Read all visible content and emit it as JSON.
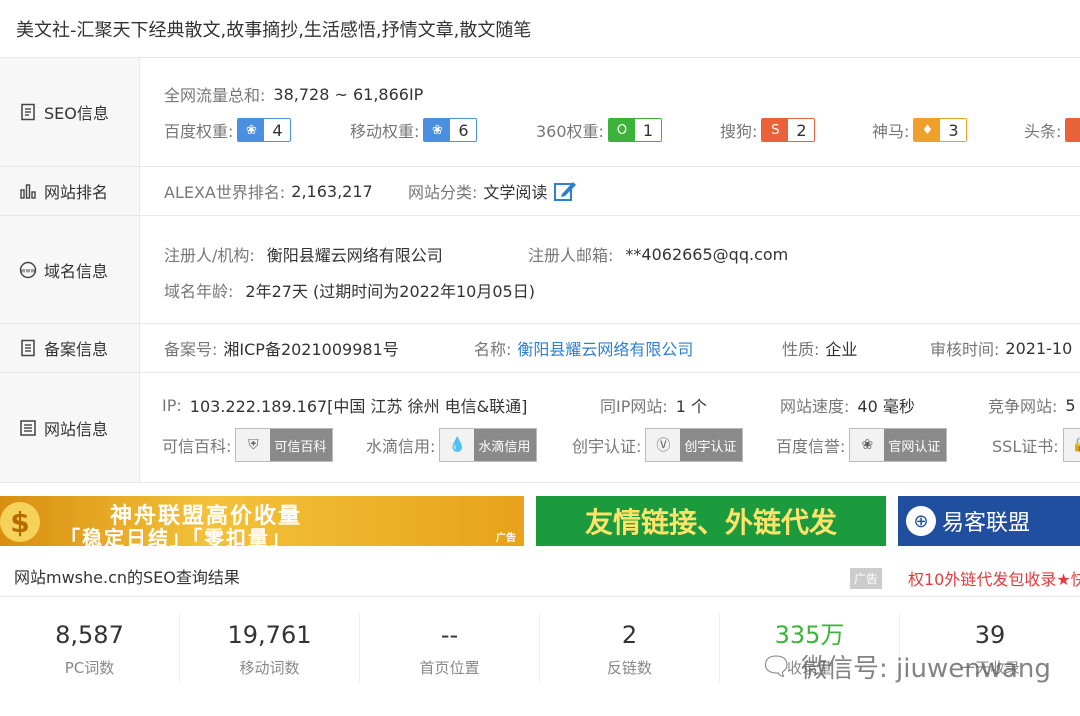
{
  "page_title": "美文社-汇聚天下经典散文,故事摘抄,生活感悟,抒情文章,散文随笔",
  "seo": {
    "label": "SEO信息",
    "traffic_key": "全网流量总和:",
    "traffic_value": "38,728 ~ 61,866IP",
    "ranks": [
      {
        "key": "百度权重:",
        "value": "4",
        "color": "#4a8fe0",
        "icon": "paw-icon"
      },
      {
        "key": "移动权重:",
        "value": "6",
        "color": "#4a8fe0",
        "icon": "paw-icon"
      },
      {
        "key": "360权重:",
        "value": "1",
        "color": "#3cb43c",
        "icon": "360-icon"
      },
      {
        "key": "搜狗:",
        "value": "2",
        "color": "#e8633a",
        "icon": "sogou-icon"
      },
      {
        "key": "神马:",
        "value": "3",
        "color": "#f0a02a",
        "icon": "shenma-icon"
      },
      {
        "key": "头条:",
        "value": "",
        "color": "#e8633a",
        "icon": "toutiao-icon"
      }
    ]
  },
  "ranking": {
    "label": "网站排名",
    "alexa_key": "ALEXA世界排名:",
    "alexa_value": "2,163,217",
    "category_key": "网站分类:",
    "category_value": "文学阅读"
  },
  "domain": {
    "label": "域名信息",
    "registrant_key": "注册人/机构:",
    "registrant_value": "衡阳县耀云网络有限公司",
    "email_key": "注册人邮箱:",
    "email_value": "**4062665@qq.com",
    "age_key": "域名年龄:",
    "age_value": "2年27天 (过期时间为2022年10月05日)"
  },
  "icp": {
    "label": "备案信息",
    "no_key": "备案号:",
    "no_value": "湘ICP备2021009981号",
    "name_key": "名称:",
    "name_value": "衡阳县耀云网络有限公司",
    "type_key": "性质:",
    "type_value": "企业",
    "date_key": "审核时间:",
    "date_value": "2021-10"
  },
  "site": {
    "label": "网站信息",
    "ip_key": "IP:",
    "ip_value": "103.222.189.167[中国 江苏 徐州 电信&联通]",
    "sameip_key": "同IP网站:",
    "sameip_value": "1 个",
    "speed_key": "网站速度:",
    "speed_value": "40 毫秒",
    "compete_key": "竞争网站:",
    "compete_value": "5",
    "certs": [
      {
        "key": "可信百科:",
        "badge": "可信百科"
      },
      {
        "key": "水滴信用:",
        "badge": "水滴信用"
      },
      {
        "key": "创宇认证:",
        "badge": "创宇认证"
      },
      {
        "key": "百度信誉:",
        "badge": "官网认证"
      },
      {
        "key": "SSL证书:",
        "badge": ""
      }
    ]
  },
  "banners": {
    "b1_line1": "神舟联盟高价收量",
    "b1_line2": "「稳定日结」「零扣量」",
    "b1_ad": "广告",
    "b2": "友情链接、外链代发",
    "b3": "易客联盟"
  },
  "result": {
    "title": "网站mwshe.cn的SEO查询结果",
    "ad_tag": "广告",
    "ad_text": "权10外链代发包收录★快"
  },
  "stats": [
    {
      "value": "8,587",
      "label": "PC词数"
    },
    {
      "value": "19,761",
      "label": "移动词数"
    },
    {
      "value": "--",
      "label": "首页位置"
    },
    {
      "value": "2",
      "label": "反链数"
    },
    {
      "value": "335万",
      "label": "收录量"
    },
    {
      "value": "39",
      "label": "一天收录"
    }
  ],
  "watermark": "微信号: jiuwenwang"
}
